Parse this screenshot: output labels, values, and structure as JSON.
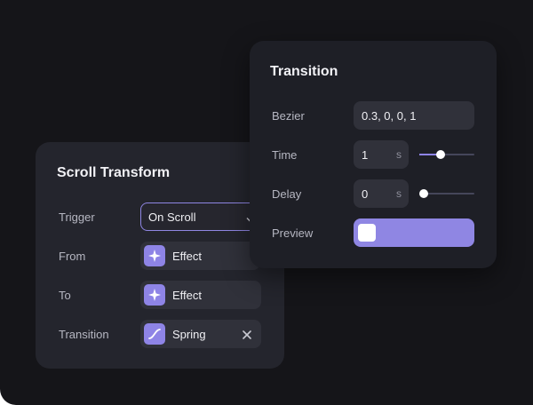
{
  "colors": {
    "background": "#151519",
    "panel": "#24252d",
    "accent": "#8e84e6"
  },
  "scroll_transform": {
    "title": "Scroll Transform",
    "trigger": {
      "label": "Trigger",
      "value": "On Scroll"
    },
    "from": {
      "label": "From",
      "value": "Effect",
      "icon": "sparkle-icon"
    },
    "to": {
      "label": "To",
      "value": "Effect",
      "icon": "sparkle-icon"
    },
    "transition": {
      "label": "Transition",
      "value": "Spring",
      "icon": "ease-curve-icon"
    }
  },
  "transition_panel": {
    "title": "Transition",
    "bezier": {
      "label": "Bezier",
      "value": "0.3, 0, 0, 1"
    },
    "time": {
      "label": "Time",
      "value": "1",
      "unit": "s",
      "slider_fraction": 0.38
    },
    "delay": {
      "label": "Delay",
      "value": "0",
      "unit": "s",
      "slider_fraction": 0.0
    },
    "preview": {
      "label": "Preview"
    }
  }
}
